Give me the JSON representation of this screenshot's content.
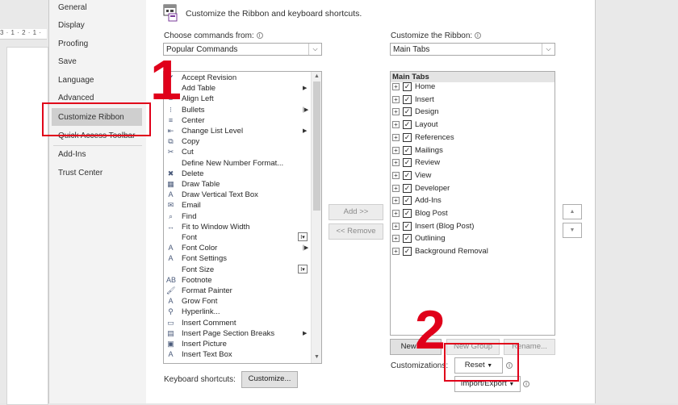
{
  "doc": {
    "ruler_text": "3 · 1 · 2 · 1 ·"
  },
  "nav": {
    "items": [
      {
        "label": "General",
        "selected": false
      },
      {
        "label": "Display",
        "selected": false
      },
      {
        "label": "Proofing",
        "selected": false
      },
      {
        "label": "Save",
        "selected": false
      },
      {
        "label": "Language",
        "selected": false
      },
      {
        "label": "Advanced",
        "selected": false
      },
      {
        "label": "Customize Ribbon",
        "selected": true
      },
      {
        "label": "Quick Access Toolbar",
        "selected": false
      },
      {
        "label": "Add-Ins",
        "selected": false
      },
      {
        "label": "Trust Center",
        "selected": false
      }
    ]
  },
  "header": {
    "title": "Customize the Ribbon and keyboard shortcuts.",
    "icon": "ribbon-customize-icon"
  },
  "left": {
    "choose_label": "Choose commands from:",
    "choose_value": "Popular Commands",
    "commands": [
      {
        "label": "Accept Revision",
        "icon": "accept-revision-icon",
        "glyph": "✔",
        "marker": ""
      },
      {
        "label": "Add Table",
        "icon": "table-icon",
        "glyph": "",
        "marker": "submenu"
      },
      {
        "label": "Align Left",
        "icon": "align-left-icon",
        "glyph": "≡",
        "marker": ""
      },
      {
        "label": "Bullets",
        "icon": "bullets-icon",
        "glyph": "⁝",
        "marker": "split"
      },
      {
        "label": "Center",
        "icon": "center-icon",
        "glyph": "≡",
        "marker": ""
      },
      {
        "label": "Change List Level",
        "icon": "list-level-icon",
        "glyph": "⇤",
        "marker": "submenu"
      },
      {
        "label": "Copy",
        "icon": "copy-icon",
        "glyph": "⧉",
        "marker": ""
      },
      {
        "label": "Cut",
        "icon": "cut-icon",
        "glyph": "✂",
        "marker": ""
      },
      {
        "label": "Define New Number Format...",
        "icon": "",
        "glyph": "",
        "marker": ""
      },
      {
        "label": "Delete",
        "icon": "delete-icon",
        "glyph": "✖",
        "marker": ""
      },
      {
        "label": "Draw Table",
        "icon": "draw-table-icon",
        "glyph": "▦",
        "marker": ""
      },
      {
        "label": "Draw Vertical Text Box",
        "icon": "text-box-icon",
        "glyph": "A",
        "marker": ""
      },
      {
        "label": "Email",
        "icon": "email-icon",
        "glyph": "✉",
        "marker": ""
      },
      {
        "label": "Find",
        "icon": "find-icon",
        "glyph": "⌕",
        "marker": ""
      },
      {
        "label": "Fit to Window Width",
        "icon": "fit-width-icon",
        "glyph": "↔",
        "marker": ""
      },
      {
        "label": "Font",
        "icon": "",
        "glyph": "",
        "marker": "combo"
      },
      {
        "label": "Font Color",
        "icon": "font-color-icon",
        "glyph": "A",
        "marker": "split"
      },
      {
        "label": "Font Settings",
        "icon": "font-settings-icon",
        "glyph": "A",
        "marker": ""
      },
      {
        "label": "Font Size",
        "icon": "",
        "glyph": "",
        "marker": "combo"
      },
      {
        "label": "Footnote",
        "icon": "footnote-icon",
        "glyph": "AB",
        "marker": ""
      },
      {
        "label": "Format Painter",
        "icon": "format-painter-icon",
        "glyph": "🖌",
        "marker": ""
      },
      {
        "label": "Grow Font",
        "icon": "grow-font-icon",
        "glyph": "A",
        "marker": ""
      },
      {
        "label": "Hyperlink...",
        "icon": "hyperlink-icon",
        "glyph": "⚲",
        "marker": ""
      },
      {
        "label": "Insert Comment",
        "icon": "comment-icon",
        "glyph": "▭",
        "marker": ""
      },
      {
        "label": "Insert Page  Section Breaks",
        "icon": "page-break-icon",
        "glyph": "▤",
        "marker": "submenu"
      },
      {
        "label": "Insert Picture",
        "icon": "picture-icon",
        "glyph": "▣",
        "marker": ""
      },
      {
        "label": "Insert Text Box",
        "icon": "text-box-icon",
        "glyph": "A",
        "marker": ""
      }
    ]
  },
  "middle": {
    "add_label": "Add >>",
    "remove_label": "<< Remove"
  },
  "right": {
    "customize_label": "Customize the Ribbon:",
    "customize_value": "Main Tabs",
    "tree_header": "Main Tabs",
    "tabs": [
      {
        "label": "Home",
        "checked": true
      },
      {
        "label": "Insert",
        "checked": true
      },
      {
        "label": "Design",
        "checked": true
      },
      {
        "label": "Layout",
        "checked": true
      },
      {
        "label": "References",
        "checked": true
      },
      {
        "label": "Mailings",
        "checked": true
      },
      {
        "label": "Review",
        "checked": true
      },
      {
        "label": "View",
        "checked": true
      },
      {
        "label": "Developer",
        "checked": true
      },
      {
        "label": "Add-Ins",
        "checked": true
      },
      {
        "label": "Blog Post",
        "checked": true
      },
      {
        "label": "Insert (Blog Post)",
        "checked": true
      },
      {
        "label": "Outlining",
        "checked": true
      },
      {
        "label": "Background Removal",
        "checked": true
      }
    ],
    "new_tab_label": "New Tab",
    "new_group_label": "New Group",
    "rename_label": "Rename...",
    "customizations_label": "Customizations:",
    "reset_label": "Reset",
    "import_export_label": "Import/Export"
  },
  "bottom": {
    "keyboard_label": "Keyboard shortcuts:",
    "customize_button": "Customize..."
  },
  "annotations": {
    "step1": "1",
    "step2": "2",
    "color": "#e0001a"
  },
  "colors": {
    "nav_bg": "#f3f3f3",
    "nav_selected": "#cfcfcf",
    "annotation": "#e0001a"
  }
}
